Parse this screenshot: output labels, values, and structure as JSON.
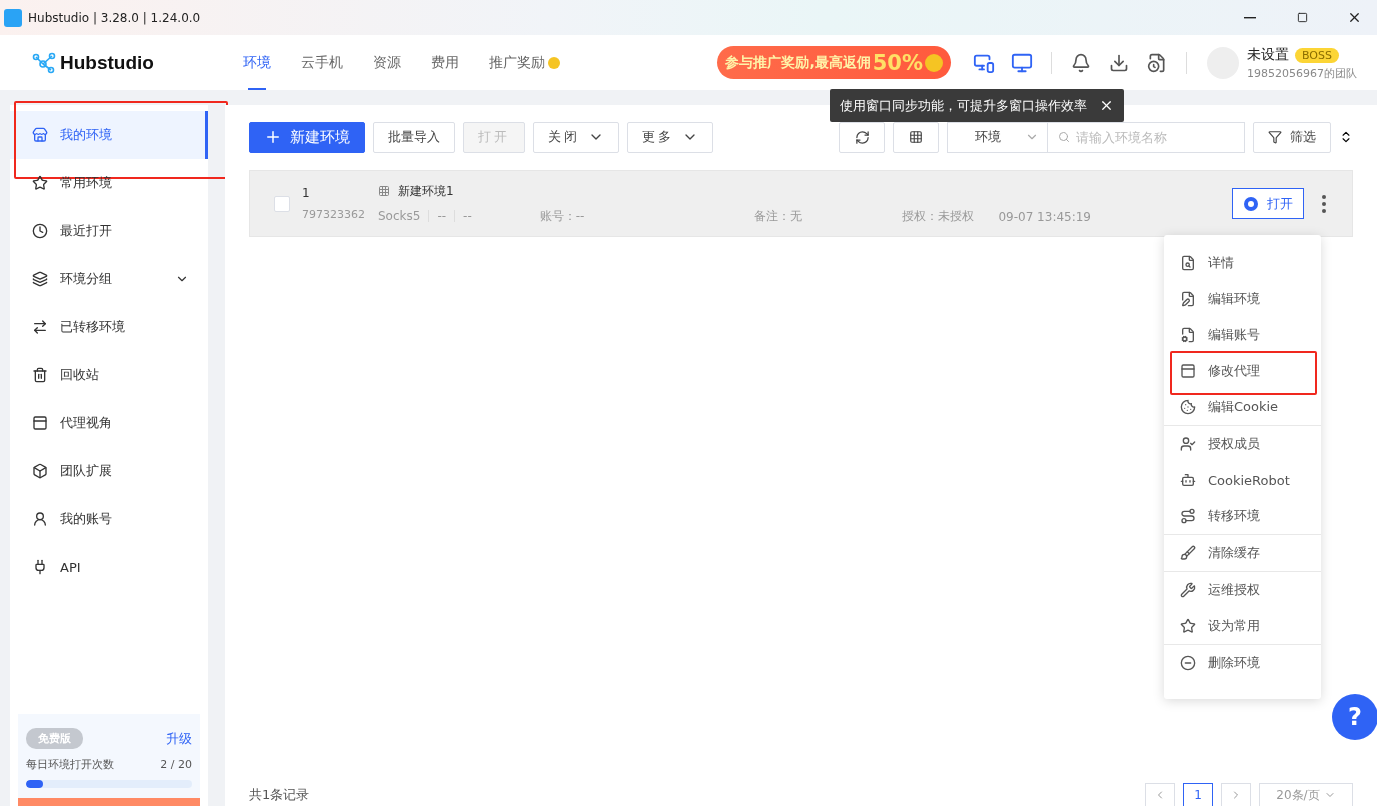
{
  "window": {
    "title": "Hubstudio | 3.28.0 | 1.24.0.0"
  },
  "header": {
    "logo": "Hubstudio",
    "nav": [
      {
        "label": "环境",
        "selected": true,
        "coin": false
      },
      {
        "label": "云手机",
        "selected": false,
        "coin": false
      },
      {
        "label": "资源",
        "selected": false,
        "coin": false
      },
      {
        "label": "费用",
        "selected": false,
        "coin": false
      },
      {
        "label": "推广奖励",
        "selected": false,
        "coin": true
      }
    ],
    "promo": {
      "text": "参与推广奖励,最高返佣",
      "percent": "50%"
    },
    "user": {
      "name": "未设置",
      "badge": "BOSS",
      "team": "19852056967的团队"
    }
  },
  "tooltip": {
    "text": "使用窗口同步功能，可提升多窗口操作效率"
  },
  "sidebar": {
    "items": [
      {
        "label": "我的环境",
        "selected": true,
        "highlighted": true,
        "expandable": false
      },
      {
        "label": "常用环境",
        "selected": false,
        "highlighted": false,
        "expandable": false
      },
      {
        "label": "最近打开",
        "selected": false,
        "highlighted": false,
        "expandable": false
      },
      {
        "label": "环境分组",
        "selected": false,
        "highlighted": false,
        "expandable": true
      },
      {
        "label": "已转移环境",
        "selected": false,
        "highlighted": false,
        "expandable": false
      },
      {
        "label": "回收站",
        "selected": false,
        "highlighted": false,
        "expandable": false
      },
      {
        "label": "代理视角",
        "selected": false,
        "highlighted": false,
        "expandable": false
      },
      {
        "label": "团队扩展",
        "selected": false,
        "highlighted": false,
        "expandable": false
      },
      {
        "label": "我的账号",
        "selected": false,
        "highlighted": false,
        "expandable": false
      },
      {
        "label": "API",
        "selected": false,
        "highlighted": false,
        "expandable": false
      }
    ],
    "plan": {
      "badge": "免费版",
      "upgrade": "升级",
      "quota_label": "每日环境打开次数",
      "quota_value": "2 / 20",
      "level": 0.1
    }
  },
  "toolbar": {
    "new_button": "新建环境",
    "import_button": "批量导入",
    "open_button": {
      "label": "打开",
      "disabled": true
    },
    "close_button": "关闭",
    "more_button": "更多",
    "env_select": "环境",
    "search_placeholder": "请输入环境名称",
    "filter_button": "筛选"
  },
  "rows": [
    {
      "checked": false,
      "index": "1",
      "id": "797323362",
      "name": "新建环境1",
      "proxy": "Socks5",
      "ip": "--",
      "region": "--",
      "account": "账号：--",
      "remark": "备注：无",
      "auth": "授权：未授权",
      "time": "09-07 13:45:19",
      "open_button": "打开"
    }
  ],
  "context_menu": {
    "groups": [
      [
        {
          "label": "详情",
          "highlighted": false
        },
        {
          "label": "编辑环境",
          "highlighted": false
        },
        {
          "label": "编辑账号",
          "highlighted": false
        },
        {
          "label": "修改代理",
          "highlighted": true
        },
        {
          "label": "编辑Cookie",
          "highlighted": false
        }
      ],
      [
        {
          "label": "授权成员",
          "highlighted": false
        },
        {
          "label": "CookieRobot",
          "highlighted": false
        },
        {
          "label": "转移环境",
          "highlighted": false
        }
      ],
      [
        {
          "label": "清除缓存",
          "highlighted": false
        }
      ],
      [
        {
          "label": "运维授权",
          "highlighted": false
        },
        {
          "label": "设为常用",
          "highlighted": false
        }
      ],
      [
        {
          "label": "删除环境",
          "highlighted": false
        }
      ]
    ]
  },
  "footer": {
    "total": "共1条记录",
    "page": "1",
    "page_size": "20条/页"
  },
  "help_button": "?"
}
